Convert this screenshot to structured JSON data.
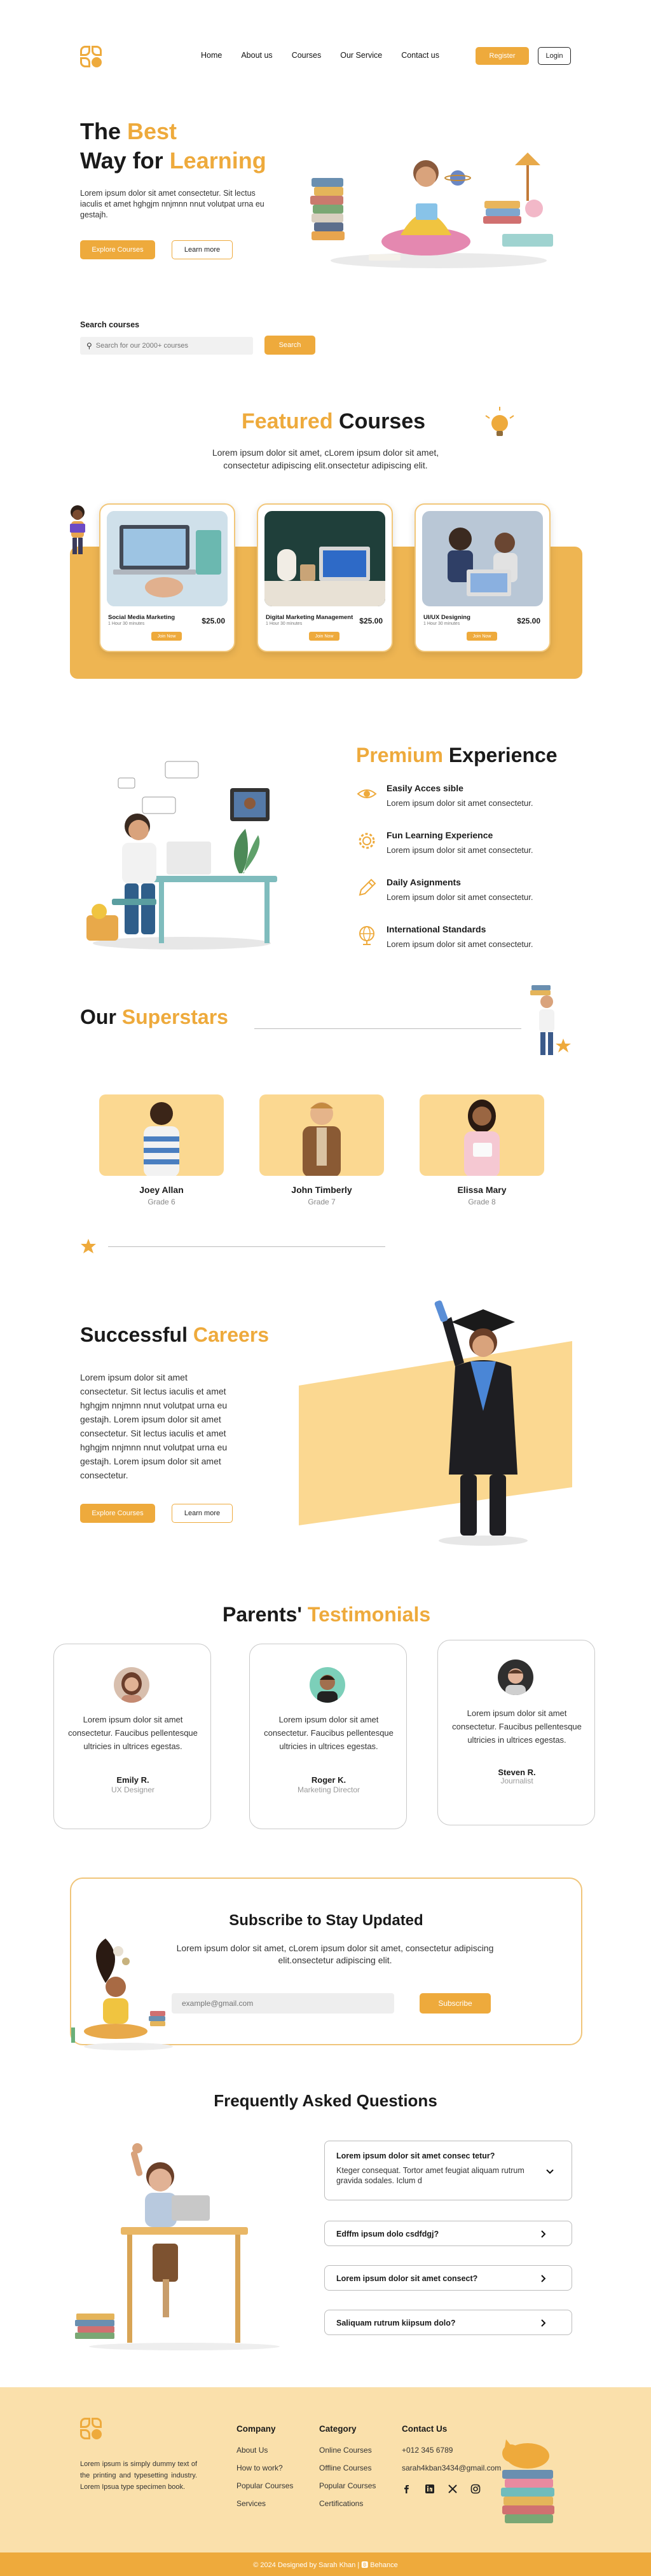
{
  "colors": {
    "accent": "#eeaa3c",
    "accent_light": "#fbd891",
    "footer_bg": "#fae0ab"
  },
  "nav": {
    "links": [
      "Home",
      "About us",
      "Courses",
      "Our Service",
      "Contact us"
    ],
    "register": "Register",
    "login": "Login"
  },
  "hero": {
    "title_1a": "The ",
    "title_1b": "Best",
    "title_2a": "Way for ",
    "title_2b": "Learning",
    "text": "Lorem ipsum dolor sit amet consectetur. Sit lectus iaculis et amet  hghgjm nnjmnn nnut volutpat urna eu  gestajh.",
    "explore": "Explore Courses",
    "learn_more": "Learn more"
  },
  "search": {
    "label": "Search courses",
    "placeholder": "Search for our 2000+ courses",
    "button": "Search"
  },
  "featured": {
    "title_a": "Featured",
    "title_b": " Courses",
    "subtitle": "Lorem ipsum dolor sit amet, cLorem ipsum dolor sit amet, consectetur adipiscing elit.onsectetur adipiscing elit.",
    "courses": [
      {
        "name": "Social Media Marketing",
        "meta": "1 Hour 30 minutes",
        "price": "$25.00",
        "button": "Join Now"
      },
      {
        "name": "Digital Marketing Management",
        "meta": "1 Hour 30 minutes",
        "price": "$25.00",
        "button": "Join Now"
      },
      {
        "name": "UI/UX Designing",
        "meta": "1 Hour 30 minutes",
        "price": "$25.00",
        "button": "Join Now"
      }
    ]
  },
  "premium": {
    "title_a": "Premium",
    "title_b": " Experience",
    "features": [
      {
        "title": "Easily Acces sible",
        "desc": "Lorem ipsum dolor sit amet consectetur.",
        "icon": "eye-icon"
      },
      {
        "title": "Fun Learning Experience",
        "desc": "Lorem ipsum dolor sit amet consectetur.",
        "icon": "gear-icon"
      },
      {
        "title": "Daily Asignments",
        "desc": "Lorem ipsum dolor sit amet consectetur.",
        "icon": "pencil-icon"
      },
      {
        "title": "International Standards",
        "desc": "Lorem ipsum dolor sit amet consectetur.",
        "icon": "globe-icon"
      }
    ]
  },
  "superstars": {
    "title_a": "Our ",
    "title_b": "Superstars",
    "students": [
      {
        "name": "Joey Allan",
        "grade": "Grade 6"
      },
      {
        "name": "John Timberly",
        "grade": "Grade 7"
      },
      {
        "name": "Elissa Mary",
        "grade": "Grade 8"
      }
    ]
  },
  "careers": {
    "title_a": "Successful ",
    "title_b": "Careers",
    "text": "Lorem ipsum dolor sit amet consectetur. Sit lectus iaculis et amet hghgjm nnjmnn nnut volutpat urna eu gestajh. Lorem ipsum dolor sit amet consectetur. Sit lectus iaculis et amet hghgjm nnjmnn nnut volutpat urna eu gestajh. Lorem ipsum dolor sit amet consectetur.",
    "explore": "Explore Courses",
    "learn_more": "Learn more"
  },
  "testimonials": {
    "title_a": "Parents' ",
    "title_b": "Testimonials",
    "items": [
      {
        "text": "Lorem ipsum dolor sit amet consectetur. Faucibus pellentesque ultricies in ultrices egestas.",
        "name": "Emily R.",
        "role": "UX Designer"
      },
      {
        "text": "Lorem ipsum dolor sit amet consectetur. Faucibus pellentesque ultricies in ultrices egestas.",
        "name": "Roger K.",
        "role": "Marketing Director"
      },
      {
        "text": "Lorem ipsum dolor sit amet consectetur. Faucibus pellentesque ultricies in ultrices egestas.",
        "name": "Steven R.",
        "role": "Journalist"
      }
    ]
  },
  "subscribe": {
    "title": "Subscribe to Stay Updated",
    "text": "Lorem ipsum dolor sit amet, cLorem ipsum dolor sit amet, consectetur adipiscing elit.onsectetur adipiscing elit.",
    "placeholder": "example@gmail.com",
    "button": "Subscribe"
  },
  "faq": {
    "title": "Frequently Asked Questions",
    "items": [
      {
        "q": "Lorem ipsum dolor sit amet consec tetur?",
        "a": "Kteger consequat. Tortor amet feugiat aliquam rutrum gravida sodales. Iclum d"
      },
      {
        "q": "Edffm  ipsum dolo csdfdgj?"
      },
      {
        "q": "Lorem ipsum dolor sit amet consect?"
      },
      {
        "q": "Saliquam rutrum kiipsum dolo?"
      }
    ]
  },
  "footer": {
    "about": "Lorem ipsum is simply dummy text of the printing and typesetting industry. Lorem Ipsua type specimen book.",
    "company": {
      "title": "Company",
      "links": [
        "About Us",
        "How to work?",
        "Popular Courses",
        "Services"
      ]
    },
    "category": {
      "title": "Category",
      "links": [
        "Online Courses",
        "Offline Courses",
        "Popular Courses",
        "Certifications"
      ]
    },
    "contact": {
      "title": "Contact Us",
      "phone": "+012 345  6789",
      "email": "sarah4kban3434@gmail.com"
    },
    "social": [
      "facebook-icon",
      "linkedin-icon",
      "x-icon",
      "instagram-icon"
    ],
    "copyright": "© 2024 Designed by Sarah Khan  |  🅱 Behance"
  }
}
